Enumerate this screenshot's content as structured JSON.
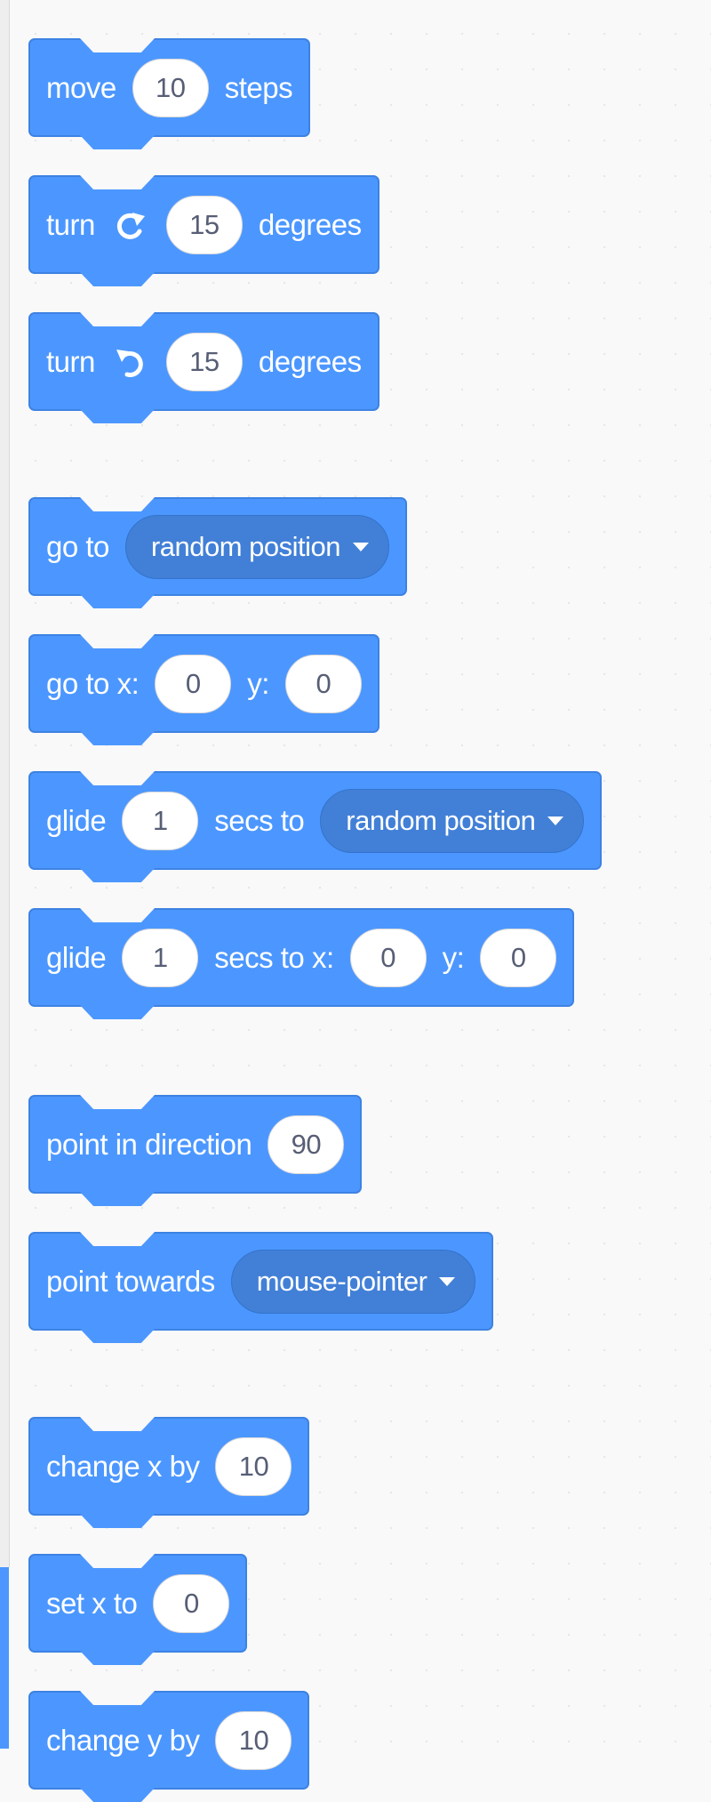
{
  "colors": {
    "motion_block": "#4c97ff",
    "motion_block_border": "#3d82e3",
    "dropdown_fill": "#4280d7",
    "palette_bg": "#f9f9f9",
    "input_text": "#575e75"
  },
  "blocks": {
    "move": {
      "p0": "move",
      "v0": "10",
      "p1": "steps"
    },
    "turn_right": {
      "p0": "turn",
      "icon": "rotate-right-icon",
      "v0": "15",
      "p1": "degrees"
    },
    "turn_left": {
      "p0": "turn",
      "icon": "rotate-left-icon",
      "v0": "15",
      "p1": "degrees"
    },
    "go_to": {
      "p0": "go to",
      "menu": "random position"
    },
    "go_to_xy": {
      "p0": "go to x:",
      "v0": "0",
      "p1": "y:",
      "v1": "0"
    },
    "glide_to": {
      "p0": "glide",
      "v0": "1",
      "p1": "secs to",
      "menu": "random position"
    },
    "glide_xy": {
      "p0": "glide",
      "v0": "1",
      "p1": "secs to x:",
      "v1": "0",
      "p2": "y:",
      "v2": "0"
    },
    "point_direction": {
      "p0": "point in direction",
      "v0": "90"
    },
    "point_towards": {
      "p0": "point towards",
      "menu": "mouse-pointer"
    },
    "change_x": {
      "p0": "change x by",
      "v0": "10"
    },
    "set_x": {
      "p0": "set x to",
      "v0": "0"
    },
    "change_y": {
      "p0": "change y by",
      "v0": "10"
    }
  }
}
